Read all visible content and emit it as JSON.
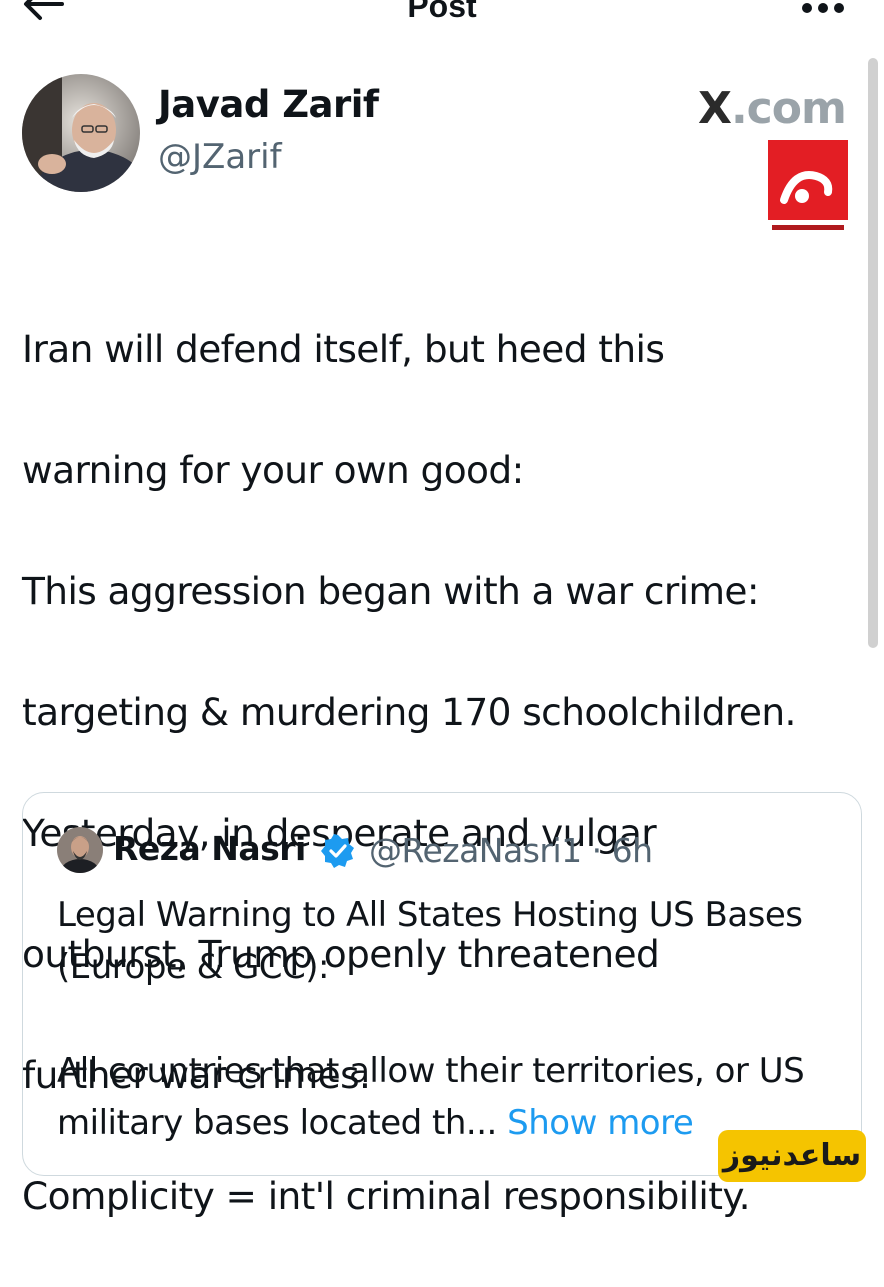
{
  "header": {
    "title": "Post",
    "back_icon": "arrow-left-icon",
    "more_icon": "more-horizontal-icon"
  },
  "author": {
    "name": "Javad Zarif",
    "handle": "@JZarif"
  },
  "watermark": {
    "site_x": "X",
    "site_rest": ".com",
    "news_badge": "ساعدنیوز",
    "logo_colors": [
      "#e31e24",
      "#ffffff"
    ]
  },
  "tweet": {
    "lines": [
      "Iran will defend itself, but heed this",
      "warning for your own good:",
      "This aggression began with a war crime:",
      "targeting & murdering 170 schoolchildren.",
      "Yesterday, in desperate and vulgar",
      "outburst, Trump openly threatened",
      "further war crimes.",
      "Complicity = int'l criminal responsibility."
    ]
  },
  "quote": {
    "name": "Reza Nasri",
    "handle_time": "@RezaNasri1 · 6h",
    "para1": "Legal Warning to All States Hosting US Bases (Europe & GCC):",
    "para2": "All countries that allow their territories, or US military bases located th...",
    "show_more": "Show more",
    "verified_color": "#1d9bf0"
  }
}
